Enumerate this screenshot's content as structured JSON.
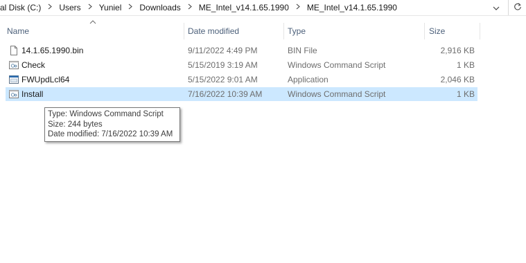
{
  "address_bar": {
    "crumbs": [
      "al Disk (C:)",
      "Users",
      "Yuniel",
      "Downloads",
      "ME_Intel_v14.1.65.1990",
      "ME_Intel_v14.1.65.1990"
    ],
    "separator_icon": "chevron-right-icon",
    "dropdown_icon": "chevron-down-icon",
    "refresh_icon": "refresh-icon"
  },
  "columns": {
    "name": "Name",
    "date_modified": "Date modified",
    "type": "Type",
    "size": "Size",
    "sort_indicator": "sort-ascending-icon"
  },
  "files": [
    {
      "name": "14.1.65.1990.bin",
      "date": "9/11/2022 4:49 PM",
      "type": "BIN File",
      "size": "2,916 KB",
      "icon": "blank-file-icon",
      "selected": false
    },
    {
      "name": "Check",
      "date": "5/15/2019 3:19 AM",
      "type": "Windows Command Script",
      "size": "1 KB",
      "icon": "command-script-icon",
      "selected": false
    },
    {
      "name": "FWUpdLcl64",
      "date": "5/15/2022 9:01 AM",
      "type": "Application",
      "size": "2,046 KB",
      "icon": "application-icon",
      "selected": false
    },
    {
      "name": "Install",
      "date": "7/16/2022 10:39 AM",
      "type": "Windows Command Script",
      "size": "1 KB",
      "icon": "command-script-icon",
      "selected": true
    }
  ],
  "tooltip": {
    "type_line": "Type: Windows Command Script",
    "size_line": "Size: 244 bytes",
    "date_line": "Date modified: 7/16/2022 10:39 AM"
  },
  "colors": {
    "selection": "#cce8ff",
    "header_text": "#4c607a",
    "secondary_text": "#6d6d6d"
  }
}
